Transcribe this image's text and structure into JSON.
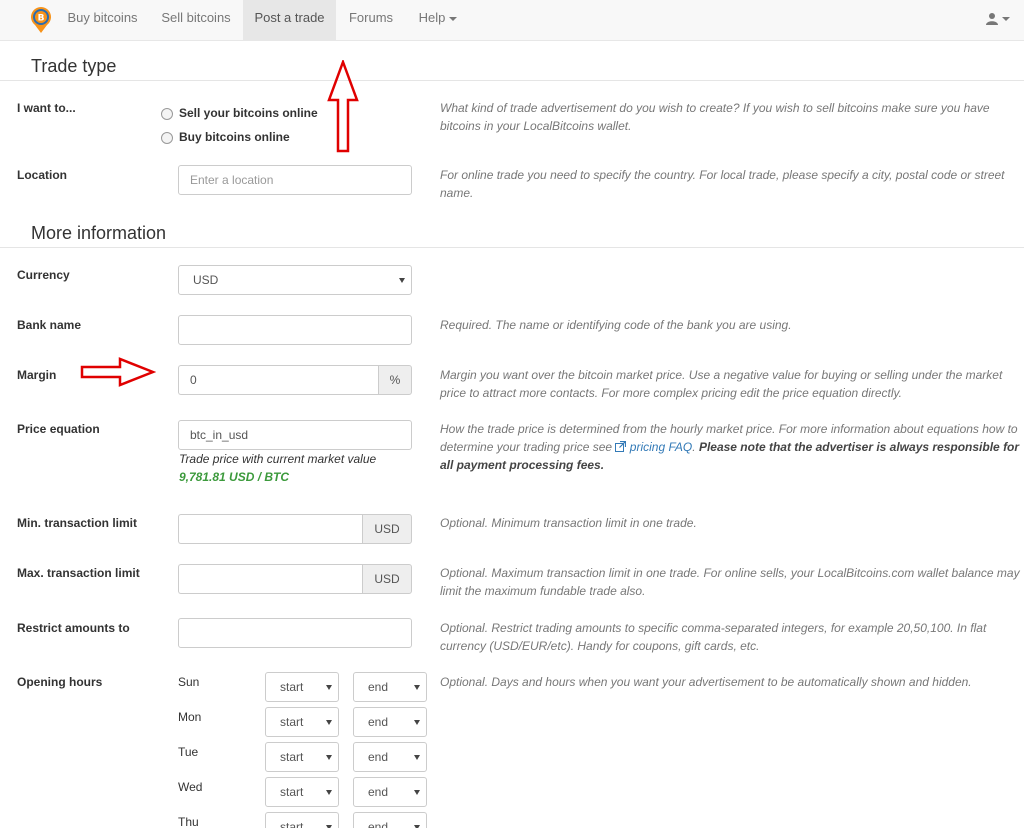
{
  "nav": {
    "items": [
      "Buy bitcoins",
      "Sell bitcoins",
      "Post a trade",
      "Forums"
    ],
    "help_label": "Help",
    "active": "Post a trade"
  },
  "sections": {
    "trade_type": "Trade type",
    "more_info": "More information"
  },
  "form": {
    "i_want": {
      "label": "I want to...",
      "options": [
        "Sell your bitcoins online",
        "Buy bitcoins online"
      ],
      "help": "What kind of trade advertisement do you wish to create? If you wish to sell bitcoins make sure you have bitcoins in your LocalBitcoins wallet."
    },
    "location": {
      "label": "Location",
      "placeholder": "Enter a location",
      "help": "For online trade you need to specify the country. For local trade, please specify a city, postal code or street name."
    },
    "currency": {
      "label": "Currency",
      "value": "USD"
    },
    "bank": {
      "label": "Bank name",
      "value": "",
      "help": "Required. The name or identifying code of the bank you are using."
    },
    "margin": {
      "label": "Margin",
      "value": "0",
      "addon": "%",
      "help": "Margin you want over the bitcoin market price. Use a negative value for buying or selling under the market price to attract more contacts. For more complex pricing edit the price equation directly."
    },
    "price_eq": {
      "label": "Price equation",
      "value": "btc_in_usd",
      "note": "Trade price with current market value",
      "price": "9,781.81 USD / BTC",
      "help_1": "How the trade price is determined from the hourly market price. For more information about equations how to determine your trading price see",
      "help_link": "pricing FAQ",
      "help_bold": "Please note that the advertiser is always responsible for all payment processing fees."
    },
    "min_limit": {
      "label": "Min. transaction limit",
      "addon": "USD",
      "help": "Optional. Minimum transaction limit in one trade."
    },
    "max_limit": {
      "label": "Max. transaction limit",
      "addon": "USD",
      "help": "Optional. Maximum transaction limit in one trade. For online sells, your LocalBitcoins.com wallet balance may limit the maximum fundable trade also."
    },
    "restrict": {
      "label": "Restrict amounts to",
      "help": "Optional. Restrict trading amounts to specific comma-separated integers, for example 20,50,100. In flat currency (USD/EUR/etc). Handy for coupons, gift cards, etc."
    },
    "hours": {
      "label": "Opening hours",
      "help": "Optional. Days and hours when you want your advertisement to be automatically shown and hidden.",
      "days": [
        "Sun",
        "Mon",
        "Tue",
        "Wed",
        "Thu"
      ],
      "start": "start",
      "end": "end"
    }
  },
  "colors": {
    "price_green": "#3c9a3c",
    "annotation_red": "#e00000",
    "link_blue": "#337ab7"
  },
  "icons": [
    "bitcoin-logo-icon",
    "user-icon",
    "external-link-icon"
  ]
}
